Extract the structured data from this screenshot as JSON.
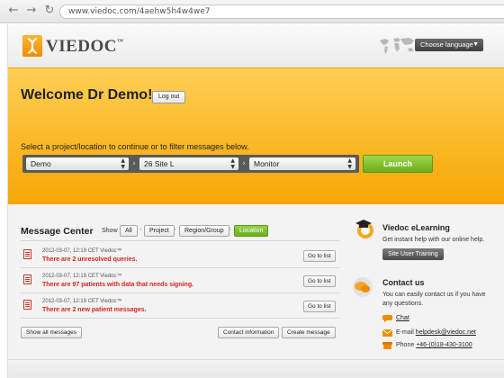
{
  "browser": {
    "back_icon": "back-arrow-icon",
    "forward_icon": "forward-arrow-icon",
    "reload_icon": "reload-icon",
    "url": "www.viedoc.com/4aehw5h4w4we7"
  },
  "header": {
    "logo_text": "VIEDOC",
    "logo_tm": "™",
    "language_button": "Choose language"
  },
  "banner": {
    "welcome": "Welcome Dr Demo!",
    "logout_label": "Log out",
    "instruction": "Select a project/location to continue or to filter messages below.",
    "selects": {
      "project": "Demo",
      "site": "26 Site L",
      "role": "Monitor"
    },
    "launch_label": "Launch"
  },
  "message_center": {
    "title": "Message Center",
    "show_label": "Show",
    "filters": [
      "All",
      "Project",
      "Region/Group",
      "Location"
    ],
    "active_filter": "Location",
    "messages": [
      {
        "meta": "2012-03-07, 12:19 CET Viedoc™",
        "text": "There are 2 unresolved queries.",
        "button": "Go to list"
      },
      {
        "meta": "2012-03-07, 12:19 CET Viedoc™",
        "text": "There are 97 patients with data that needs signing.",
        "button": "Go to list"
      },
      {
        "meta": "2012-03-07, 12:19 CET Viedoc™",
        "text": "There are 2 new patient messages.",
        "button": "Go to list"
      }
    ],
    "show_all_label": "Show all messages",
    "contact_info_label": "Contact information",
    "create_message_label": "Create message"
  },
  "elearning": {
    "title": "Viedoc eLearning",
    "text": "Get instant help with our online help.",
    "button": "Site User Training"
  },
  "contact": {
    "title": "Contact us",
    "text_line1": "You can easily contact us if you have",
    "text_line2": "any questions.",
    "chat_label": "Chat",
    "email_prefix": "E-mail",
    "email": "helpdesk@viedoc.net",
    "phone_prefix": "Phone",
    "phone": "+46-(0)18-430-3100"
  },
  "colors": {
    "brand_orange": "#f9b21a",
    "launch_green": "#6cae1e",
    "alert_red": "#d3261c"
  }
}
